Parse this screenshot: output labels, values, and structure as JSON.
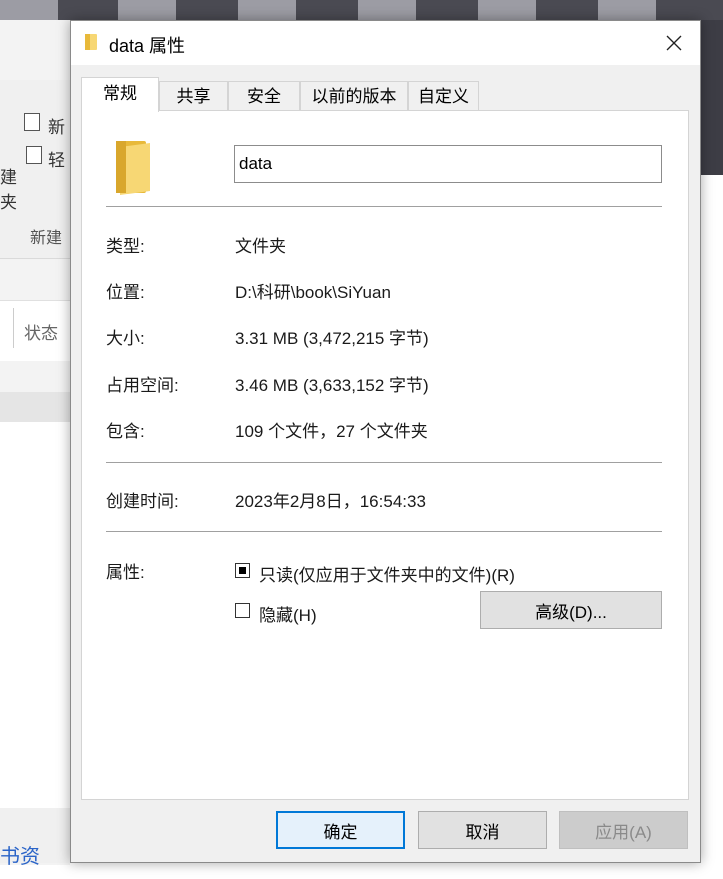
{
  "background": {
    "ribbon_item_1": "新",
    "ribbon_item_2": "轻",
    "ribbon_left_1": "建",
    "ribbon_left_2": "夹",
    "group_label": "新建",
    "column_header": "状态",
    "link_text": "书资"
  },
  "dialog": {
    "title": "data 属性",
    "close_icon": "close-icon",
    "tabs": [
      {
        "label": "常规",
        "active": true
      },
      {
        "label": "共享",
        "active": false
      },
      {
        "label": "安全",
        "active": false
      },
      {
        "label": "以前的版本",
        "active": false
      },
      {
        "label": "自定义",
        "active": false
      }
    ],
    "general": {
      "folder_name": "data",
      "properties": [
        {
          "label": "类型:",
          "value": "文件夹"
        },
        {
          "label": "位置:",
          "value": "D:\\科研\\book\\SiYuan"
        },
        {
          "label": "大小:",
          "value": "3.31 MB (3,472,215 字节)"
        },
        {
          "label": "占用空间:",
          "value": "3.46 MB (3,633,152 字节)"
        },
        {
          "label": "包含:",
          "value": "109 个文件，27 个文件夹"
        }
      ],
      "created": {
        "label": "创建时间:",
        "value": "2023年2月8日，16:54:33"
      },
      "attributes": {
        "label": "属性:",
        "readonly": {
          "label": "只读(仅应用于文件夹中的文件)(R)",
          "state": "indeterminate"
        },
        "hidden": {
          "label": "隐藏(H)",
          "state": "unchecked"
        },
        "advanced_button": "高级(D)..."
      }
    },
    "buttons": {
      "ok": "确定",
      "cancel": "取消",
      "apply": "应用(A)"
    },
    "colors": {
      "accent": "#0078d7",
      "folder": "#f7d774"
    }
  }
}
